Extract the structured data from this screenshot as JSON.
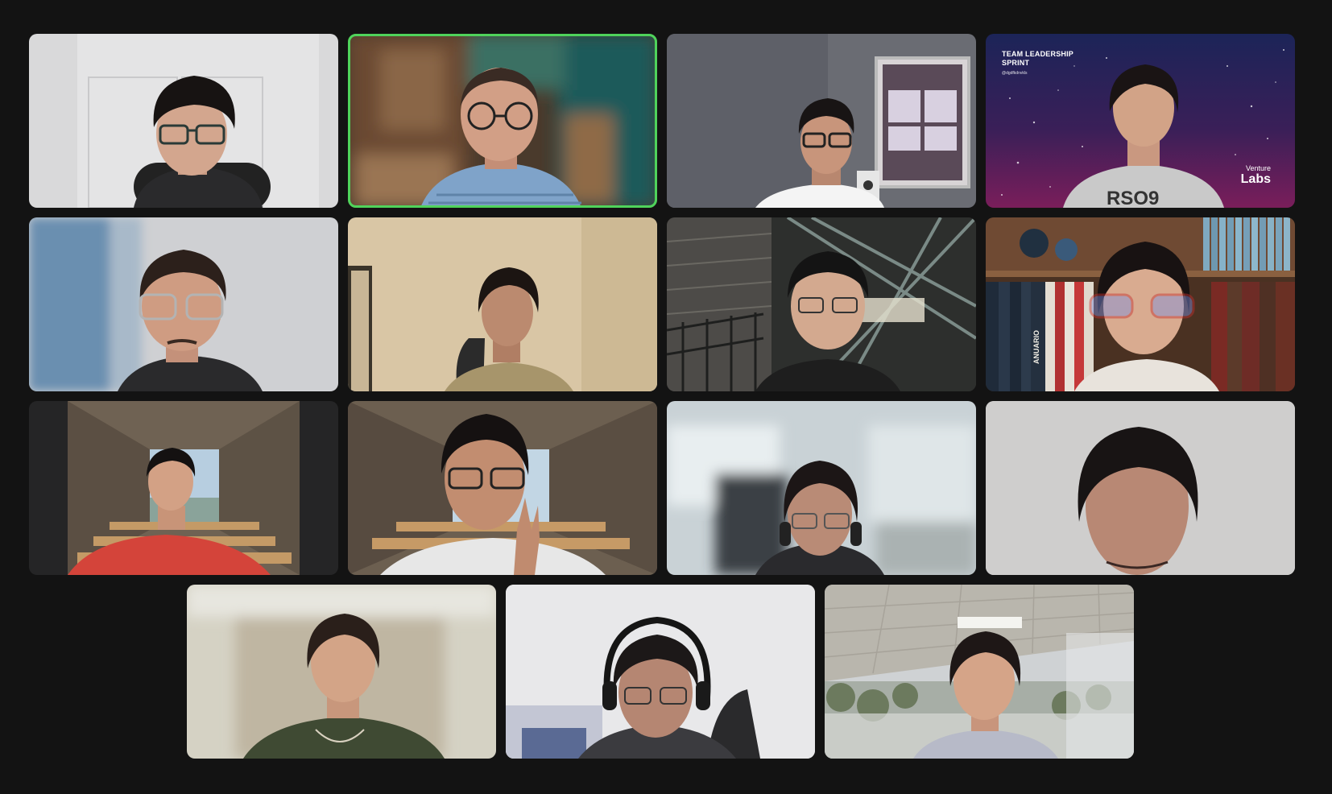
{
  "meeting": {
    "layout": "gallery",
    "active_speaker_index": 2,
    "participant_count": 15
  },
  "tiles": [
    {
      "id": 1
    },
    {
      "id": 2,
      "active_speaker": true
    },
    {
      "id": 3
    },
    {
      "id": 4,
      "background_text": {
        "title": "TEAM LEADERSHIP SPRINT",
        "handle": "@dgdfkdnvkls",
        "brand_line1": "Venture",
        "brand_line2": "Labs"
      }
    },
    {
      "id": 5
    },
    {
      "id": 6
    },
    {
      "id": 7
    },
    {
      "id": 8,
      "book_spine_text": "ANUARIO"
    },
    {
      "id": 9
    },
    {
      "id": 10
    },
    {
      "id": 11
    },
    {
      "id": 12
    },
    {
      "id": 13
    },
    {
      "id": 14
    },
    {
      "id": 15
    }
  ],
  "colors": {
    "background": "#131313",
    "active_speaker_border": "#4fd35b"
  }
}
